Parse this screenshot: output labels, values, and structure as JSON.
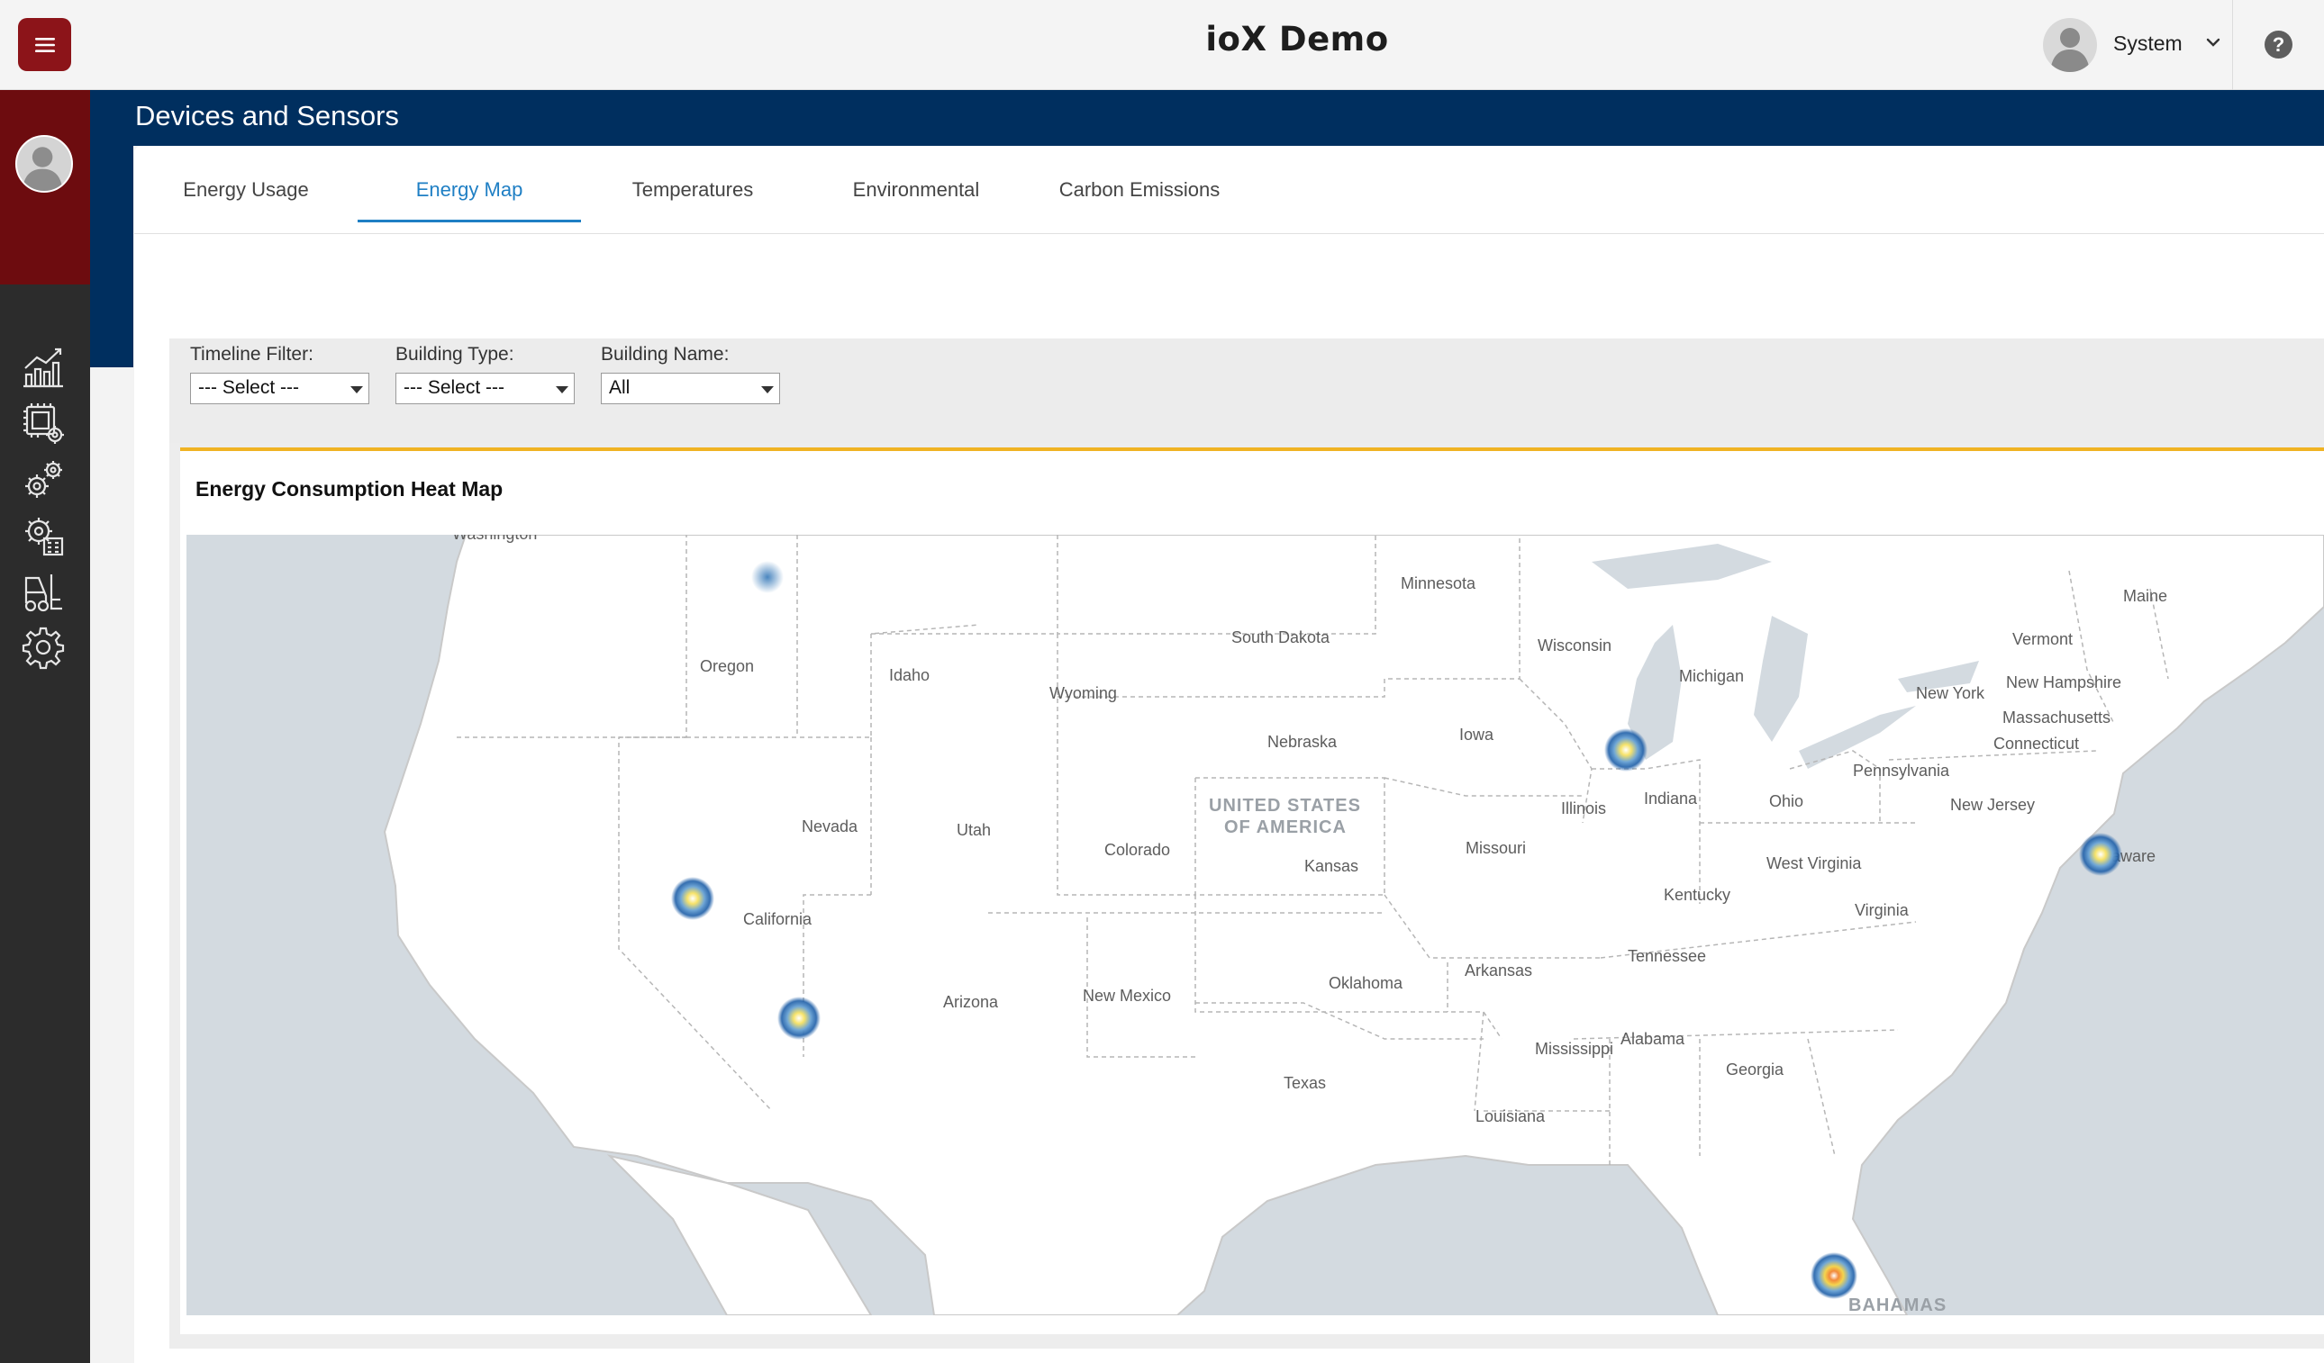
{
  "app": {
    "title": "ioX Demo"
  },
  "user": {
    "name": "System"
  },
  "page": {
    "title": "Devices and Sensors"
  },
  "tabs": [
    {
      "label": "Energy Usage",
      "active": false
    },
    {
      "label": "Energy Map",
      "active": true
    },
    {
      "label": "Temperatures",
      "active": false
    },
    {
      "label": "Environmental",
      "active": false
    },
    {
      "label": "Carbon Emissions",
      "active": false
    }
  ],
  "filters": {
    "timeline": {
      "label": "Timeline Filter:",
      "value": "--- Select ---"
    },
    "building_type": {
      "label": "Building Type:",
      "value": "--- Select ---"
    },
    "building_name": {
      "label": "Building Name:",
      "value": "All"
    }
  },
  "card": {
    "title": "Energy Consumption Heat Map"
  },
  "map": {
    "country_label_1": "UNITED STATES",
    "country_label_2": "OF AMERICA",
    "bahamas": "BAHAMAS",
    "states": {
      "washington": "Washington",
      "oregon": "Oregon",
      "idaho": "Idaho",
      "wyoming": "Wyoming",
      "south_dakota": "South Dakota",
      "minnesota": "Minnesota",
      "wisconsin": "Wisconsin",
      "michigan": "Michigan",
      "maine": "Maine",
      "vermont": "Vermont",
      "new_hampshire": "New Hampshire",
      "new_york": "New York",
      "massachusetts": "Massachusetts",
      "connecticut": "Connecticut",
      "nebraska": "Nebraska",
      "iowa": "Iowa",
      "pennsylvania": "Pennsylvania",
      "new_jersey": "New Jersey",
      "nevada": "Nevada",
      "utah": "Utah",
      "colorado": "Colorado",
      "kansas": "Kansas",
      "missouri": "Missouri",
      "illinois": "Illinois",
      "indiana": "Indiana",
      "ohio": "Ohio",
      "delaware": "Delaware",
      "west_virginia": "West Virginia",
      "kentucky": "Kentucky",
      "virginia": "Virginia",
      "california": "California",
      "tennessee": "Tennessee",
      "arizona": "Arizona",
      "new_mexico": "New Mexico",
      "oklahoma": "Oklahoma",
      "arkansas": "Arkansas",
      "mississippi": "Mississippi",
      "alabama": "Alabama",
      "georgia": "Georgia",
      "texas": "Texas",
      "louisiana": "Louisiana"
    }
  },
  "icons": {
    "menu": "hamburger-menu-icon",
    "help": "question-mark-icon",
    "rail": [
      "analytics-chart-icon",
      "device-settings-icon",
      "gears-icon",
      "building-settings-icon",
      "forklift-icon",
      "settings-gear-icon"
    ]
  },
  "colors": {
    "brand_red": "#8c1419",
    "header_navy": "#002f5f",
    "accent_blue": "#1f7fc4",
    "card_accent": "#f0b323"
  }
}
